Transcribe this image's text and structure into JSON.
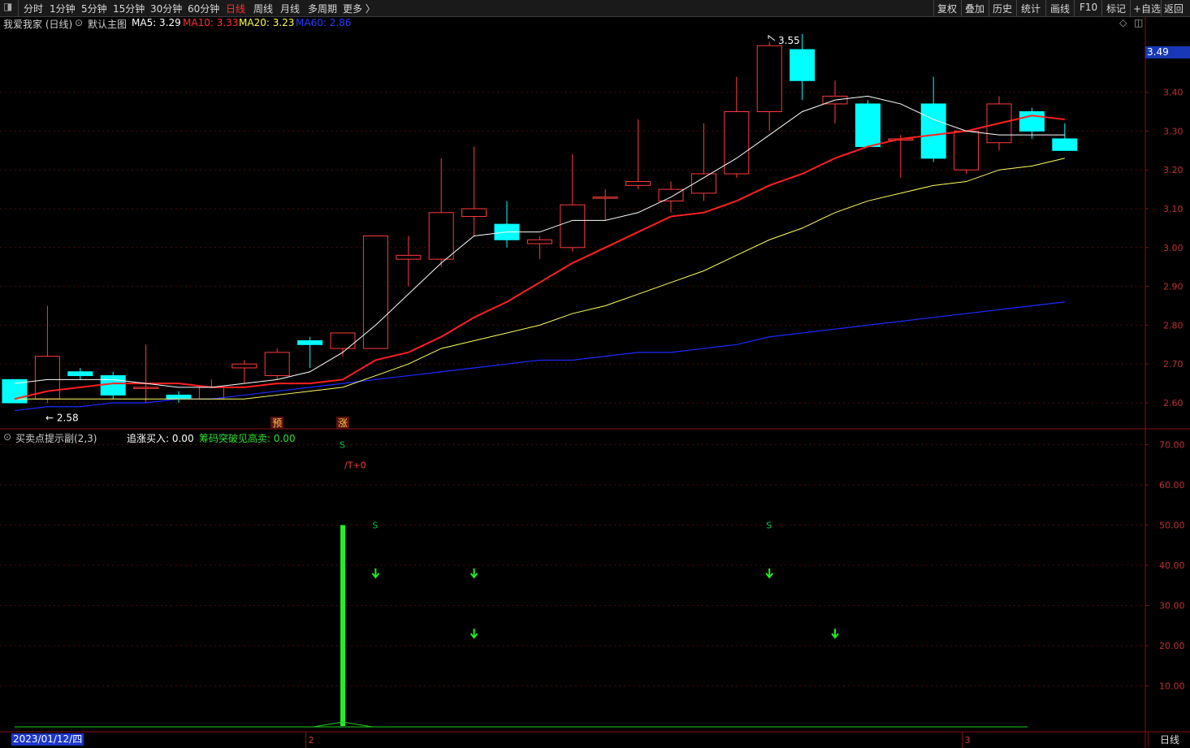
{
  "toolbar": {
    "periods": [
      "分时",
      "1分钟",
      "5分钟",
      "15分钟",
      "30分钟",
      "60分钟",
      "日线",
      "周线",
      "月线",
      "多周期",
      "更多 〉"
    ],
    "active_period": "日线",
    "right_items": [
      "复权",
      "叠加",
      "历史",
      "统计",
      "画线",
      "F10",
      "标记",
      "+自选",
      "返回"
    ]
  },
  "info": {
    "stock": "我爱我家 (日线)",
    "indicator_name": "默认主图",
    "ma5": "MA5: 3.29",
    "ma10": "MA10: 3.33",
    "ma20": "MA20: 3.23",
    "ma60": "MA60: 2.86"
  },
  "sub": {
    "name": "买卖点提示副(2,3)",
    "item1": "追涨买入: 0.00",
    "item2": "筹码突破见高卖: 0.00"
  },
  "price_tag": "3.49",
  "date_label": "2023/01/12/四",
  "period_label": "日线",
  "month_markers": [
    "2",
    "3"
  ],
  "colors": {
    "up": "#ff3b3b",
    "down": "#00ffff",
    "ma5": "#ffffff",
    "ma10": "#ff2020",
    "ma20": "#ffff60",
    "ma60": "#1a2cff",
    "grid": "#4a0e0e"
  },
  "chart_data": [
    {
      "type": "candlestick",
      "title": "我爱我家 (日线)",
      "y_ticks": [
        "3.40",
        "3.30",
        "3.20",
        "3.10",
        "3.00",
        "2.90",
        "2.80",
        "2.70",
        "2.60"
      ],
      "ylim": [
        2.55,
        3.55
      ],
      "annotations": {
        "high": "3.55",
        "low": "← 2.58",
        "pre": "预",
        "rise": "涨"
      },
      "candles": [
        {
          "o": 2.66,
          "h": 2.66,
          "l": 2.6,
          "c": 2.6
        },
        {
          "o": 2.61,
          "h": 2.85,
          "l": 2.6,
          "c": 2.72
        },
        {
          "o": 2.68,
          "h": 2.69,
          "l": 2.66,
          "c": 2.67
        },
        {
          "o": 2.67,
          "h": 2.68,
          "l": 2.61,
          "c": 2.62
        },
        {
          "o": 2.64,
          "h": 2.75,
          "l": 2.6,
          "c": 2.64
        },
        {
          "o": 2.62,
          "h": 2.63,
          "l": 2.6,
          "c": 2.61
        },
        {
          "o": 2.61,
          "h": 2.66,
          "l": 2.61,
          "c": 2.64
        },
        {
          "o": 2.69,
          "h": 2.71,
          "l": 2.65,
          "c": 2.7
        },
        {
          "o": 2.67,
          "h": 2.74,
          "l": 2.66,
          "c": 2.73
        },
        {
          "o": 2.76,
          "h": 2.77,
          "l": 2.69,
          "c": 2.75
        },
        {
          "o": 2.74,
          "h": 2.78,
          "l": 2.72,
          "c": 2.78
        },
        {
          "o": 2.74,
          "h": 3.03,
          "l": 2.74,
          "c": 3.03
        },
        {
          "o": 2.97,
          "h": 3.03,
          "l": 2.9,
          "c": 2.98
        },
        {
          "o": 2.97,
          "h": 3.23,
          "l": 2.95,
          "c": 3.09
        },
        {
          "o": 3.08,
          "h": 3.26,
          "l": 3.03,
          "c": 3.1
        },
        {
          "o": 3.06,
          "h": 3.12,
          "l": 3.0,
          "c": 3.02
        },
        {
          "o": 3.01,
          "h": 3.03,
          "l": 2.97,
          "c": 3.02
        },
        {
          "o": 3.0,
          "h": 3.24,
          "l": 2.99,
          "c": 3.11
        },
        {
          "o": 3.13,
          "h": 3.15,
          "l": 3.07,
          "c": 3.13
        },
        {
          "o": 3.16,
          "h": 3.33,
          "l": 3.15,
          "c": 3.17
        },
        {
          "o": 3.12,
          "h": 3.17,
          "l": 3.09,
          "c": 3.15
        },
        {
          "o": 3.14,
          "h": 3.32,
          "l": 3.12,
          "c": 3.19
        },
        {
          "o": 3.19,
          "h": 3.44,
          "l": 3.18,
          "c": 3.35
        },
        {
          "o": 3.35,
          "h": 3.53,
          "l": 3.3,
          "c": 3.52
        },
        {
          "o": 3.51,
          "h": 3.55,
          "l": 3.38,
          "c": 3.43
        },
        {
          "o": 3.37,
          "h": 3.43,
          "l": 3.32,
          "c": 3.39
        },
        {
          "o": 3.37,
          "h": 3.38,
          "l": 3.26,
          "c": 3.26
        },
        {
          "o": 3.28,
          "h": 3.29,
          "l": 3.18,
          "c": 3.28
        },
        {
          "o": 3.37,
          "h": 3.44,
          "l": 3.22,
          "c": 3.23
        },
        {
          "o": 3.2,
          "h": 3.29,
          "l": 3.19,
          "c": 3.3
        },
        {
          "o": 3.27,
          "h": 3.39,
          "l": 3.25,
          "c": 3.37
        },
        {
          "o": 3.35,
          "h": 3.36,
          "l": 3.28,
          "c": 3.3
        },
        {
          "o": 3.28,
          "h": 3.32,
          "l": 3.25,
          "c": 3.25
        }
      ],
      "ma5": [
        2.65,
        2.66,
        2.66,
        2.66,
        2.65,
        2.64,
        2.64,
        2.65,
        2.66,
        2.68,
        2.73,
        2.8,
        2.88,
        2.96,
        3.03,
        3.04,
        3.04,
        3.07,
        3.07,
        3.09,
        3.13,
        3.18,
        3.23,
        3.29,
        3.35,
        3.38,
        3.39,
        3.37,
        3.33,
        3.3,
        3.29,
        3.29,
        3.29
      ],
      "ma10": [
        2.61,
        2.63,
        2.64,
        2.65,
        2.65,
        2.65,
        2.64,
        2.64,
        2.65,
        2.65,
        2.66,
        2.71,
        2.73,
        2.77,
        2.82,
        2.86,
        2.91,
        2.96,
        3.0,
        3.04,
        3.08,
        3.09,
        3.12,
        3.16,
        3.19,
        3.23,
        3.26,
        3.28,
        3.29,
        3.3,
        3.32,
        3.34,
        3.33
      ],
      "ma20": [
        2.61,
        2.61,
        2.61,
        2.61,
        2.61,
        2.61,
        2.61,
        2.61,
        2.62,
        2.63,
        2.64,
        2.67,
        2.7,
        2.74,
        2.76,
        2.78,
        2.8,
        2.83,
        2.85,
        2.88,
        2.91,
        2.94,
        2.98,
        3.02,
        3.05,
        3.09,
        3.12,
        3.14,
        3.16,
        3.17,
        3.2,
        3.21,
        3.23
      ],
      "ma60": [
        2.58,
        2.59,
        2.59,
        2.6,
        2.6,
        2.61,
        2.61,
        2.62,
        2.63,
        2.64,
        2.65,
        2.66,
        2.67,
        2.68,
        2.69,
        2.7,
        2.71,
        2.71,
        2.72,
        2.73,
        2.73,
        2.74,
        2.75,
        2.77,
        2.78,
        2.79,
        2.8,
        2.81,
        2.82,
        2.83,
        2.84,
        2.85,
        2.86
      ]
    },
    {
      "type": "bar",
      "title": "买卖点提示副(2,3)",
      "y_ticks": [
        "70.00",
        "60.00",
        "50.00",
        "40.00",
        "30.00",
        "20.00",
        "10.00"
      ],
      "ylim": [
        0,
        72
      ],
      "bars": [
        {
          "index": 10,
          "value": 50
        }
      ],
      "texts": [
        {
          "index": 10,
          "text": "S",
          "value": 70,
          "color": "#00cc44"
        },
        {
          "index": 10,
          "text": "/T+0",
          "value": 65,
          "color": "#ff3b3b"
        },
        {
          "index": 11,
          "text": "S",
          "value": 50,
          "color": "#00cc44"
        },
        {
          "index": 23,
          "text": "S",
          "value": 50,
          "color": "#00cc44"
        }
      ],
      "arrows": [
        {
          "index": 11,
          "value": 38
        },
        {
          "index": 14,
          "value": 38
        },
        {
          "index": 14,
          "value": 23
        },
        {
          "index": 23,
          "value": 38
        },
        {
          "index": 25,
          "value": 23
        }
      ]
    }
  ]
}
